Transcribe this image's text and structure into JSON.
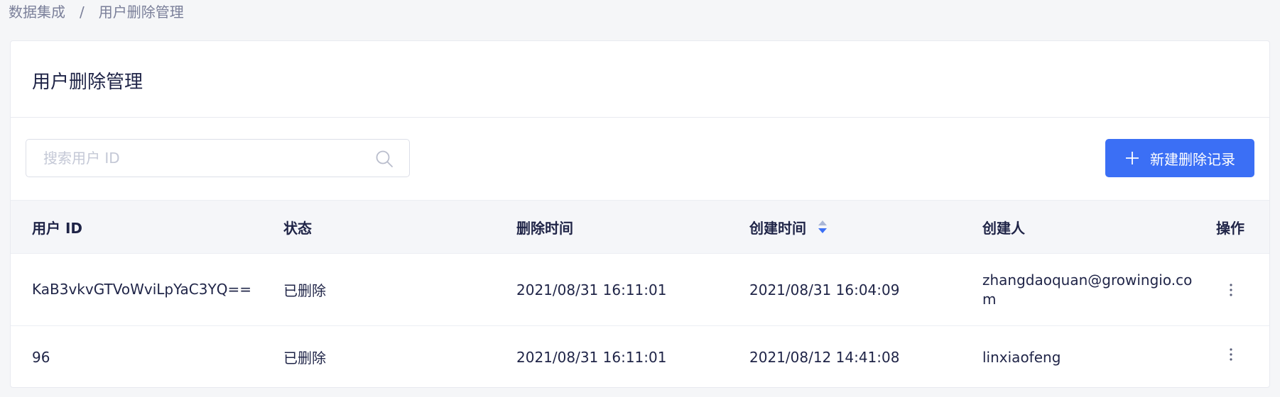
{
  "breadcrumb": {
    "parent": "数据集成",
    "separator": "/",
    "current": "用户删除管理"
  },
  "page": {
    "title": "用户删除管理"
  },
  "search": {
    "placeholder": "搜索用户 ID",
    "value": ""
  },
  "toolbar": {
    "new_button_label": "新建删除记录"
  },
  "table": {
    "columns": [
      "用户 ID",
      "状态",
      "删除时间",
      "创建时间",
      "创建人",
      "操作"
    ],
    "rows": [
      {
        "user_id": "KaB3vkvGTVoWviLpYaC3YQ==",
        "status": "已删除",
        "deleted_at": "2021/08/31 16:11:01",
        "created_at": "2021/08/31 16:04:09",
        "creator": "zhangdaoquan@growingio.com"
      },
      {
        "user_id": "96",
        "status": "已删除",
        "deleted_at": "2021/08/31 16:11:01",
        "created_at": "2021/08/12 14:41:08",
        "creator": "linxiaofeng"
      }
    ]
  },
  "colors": {
    "primary": "#3b6ff5",
    "text": "#1f2447",
    "muted": "#7a7f99",
    "border": "#e8eaf0",
    "header_bg": "#f5f6f9"
  },
  "icons": {
    "search": "search-icon",
    "plus": "plus-icon",
    "sort": "sort-icon",
    "more": "more-vertical-icon"
  }
}
